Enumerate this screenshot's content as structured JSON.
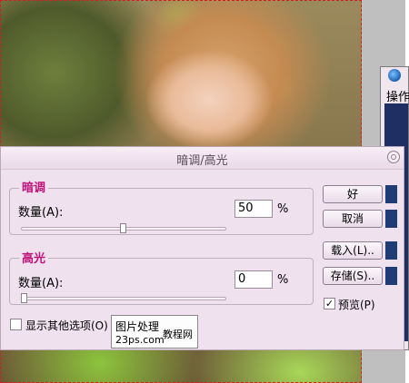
{
  "dialog": {
    "title": "暗调/高光",
    "shadows": {
      "group_label": "暗调",
      "amount_label": "数量(A):",
      "amount_value": "50",
      "unit": "%",
      "slider_percent": 50
    },
    "highlights": {
      "group_label": "高光",
      "amount_label": "数量(A):",
      "amount_value": "0",
      "unit": "%",
      "slider_percent": 0
    },
    "more_options_label": "显示其他选项(O)",
    "more_options_checked": false,
    "buttons": {
      "ok": "好",
      "cancel": "取消",
      "load": "载入(L)..",
      "save": "存储(S).."
    },
    "preview_label": "预览(P)",
    "preview_checked": true,
    "preview_mark": "✓"
  },
  "ops_panel": {
    "tab_label": "操作"
  },
  "watermark": {
    "title": "图片处理",
    "subtitle": "教程网",
    "url": "23ps.com"
  }
}
